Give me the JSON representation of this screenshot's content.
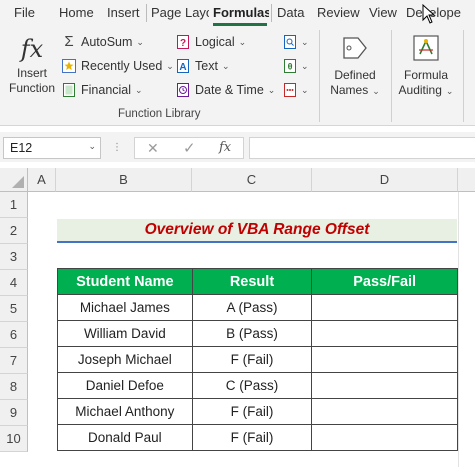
{
  "tabs": [
    {
      "label": "File",
      "active": false
    },
    {
      "label": "Home",
      "active": false
    },
    {
      "label": "Insert",
      "active": false
    },
    {
      "label": "Page Layo",
      "active": false
    },
    {
      "label": "Formulas",
      "active": true
    },
    {
      "label": "Data",
      "active": false
    },
    {
      "label": "Review",
      "active": false
    },
    {
      "label": "View",
      "active": false
    },
    {
      "label": "Develope",
      "active": false
    }
  ],
  "ribbon": {
    "insert_function": {
      "line1": "Insert",
      "line2": "Function",
      "icon": "fx-icon"
    },
    "items": [
      {
        "label": "AutoSum",
        "icon": "sigma-icon"
      },
      {
        "label": "Recently Used",
        "icon": "star-icon"
      },
      {
        "label": "Financial",
        "icon": "book-icon"
      },
      {
        "label": "Logical",
        "icon": "question-book-icon"
      },
      {
        "label": "Text",
        "icon": "text-a-icon"
      },
      {
        "label": "Date & Time",
        "icon": "clock-book-icon"
      }
    ],
    "group_label": "Function Library",
    "defined_names": {
      "line1": "Defined",
      "line2": "Names"
    },
    "formula_auditing": {
      "line1": "Formula",
      "line2": "Auditing"
    },
    "accent_color": "#217346"
  },
  "formula_bar": {
    "name_box": "E12",
    "cancel_icon": "✕",
    "enter_icon": "✓",
    "fx_label": "fx",
    "formula": ""
  },
  "grid": {
    "columns": [
      "A",
      "B",
      "C",
      "D"
    ],
    "rows": [
      "1",
      "2",
      "3",
      "4",
      "5",
      "6",
      "7",
      "8",
      "9",
      "10"
    ]
  },
  "sheet": {
    "title": "Overview of VBA Range Offset",
    "title_color": "#c00000",
    "header_color": "#00b050",
    "headers": [
      "Student Name",
      "Result",
      "Pass/Fail"
    ],
    "rows": [
      {
        "name": "Michael James",
        "result": "A (Pass)",
        "pass_fail": ""
      },
      {
        "name": "William David",
        "result": "B (Pass)",
        "pass_fail": ""
      },
      {
        "name": "Joseph Michael",
        "result": "F (Fail)",
        "pass_fail": ""
      },
      {
        "name": "Daniel Defoe",
        "result": "C (Pass)",
        "pass_fail": ""
      },
      {
        "name": "Michael Anthony",
        "result": "F (Fail)",
        "pass_fail": ""
      },
      {
        "name": "Donald Paul",
        "result": "F (Fail)",
        "pass_fail": ""
      }
    ]
  }
}
